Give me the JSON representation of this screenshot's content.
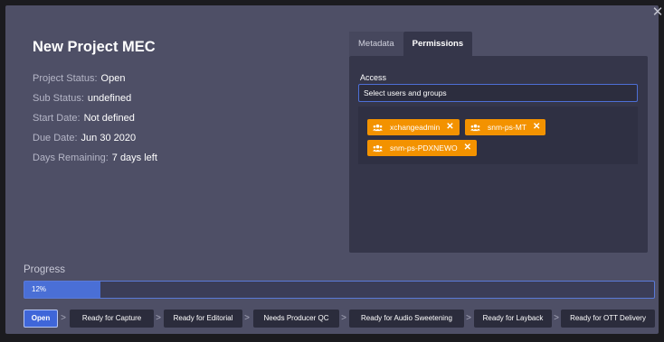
{
  "modal": {
    "title": "New Project MEC",
    "close_glyph": "✕"
  },
  "info": [
    {
      "label": "Project Status:",
      "value": "Open"
    },
    {
      "label": "Sub Status:",
      "value": "undefined"
    },
    {
      "label": "Start Date:",
      "value": "Not defined"
    },
    {
      "label": "Due Date:",
      "value": "Jun 30 2020"
    },
    {
      "label": "Days Remaining:",
      "value": "7 days left"
    }
  ],
  "tabs": [
    {
      "label": "Metadata",
      "active": false
    },
    {
      "label": "Permissions",
      "active": true
    }
  ],
  "permissions": {
    "access_label": "Access",
    "select_placeholder": "Select users and groups",
    "chips": [
      {
        "label": "xchangeadmin",
        "icon": "group-icon"
      },
      {
        "label": "snm-ps-MT",
        "icon": "group-icon"
      },
      {
        "label": "snm-ps-PDXNEWO",
        "icon": "group-icon"
      }
    ],
    "chip_color": "#f39200"
  },
  "progress": {
    "label": "Progress",
    "percent_text": "12%",
    "percent": 12,
    "fill_color": "#4a6fd6"
  },
  "steps": [
    {
      "label": "Open",
      "current": true
    },
    {
      "label": "Ready for Capture",
      "current": false
    },
    {
      "label": "Ready for Editorial",
      "current": false
    },
    {
      "label": "Needs Producer QC",
      "current": false
    },
    {
      "label": "Ready for Audio Sweetening",
      "current": false
    },
    {
      "label": "Ready for Layback",
      "current": false
    },
    {
      "label": "Ready for OTT Delivery",
      "current": false
    }
  ],
  "step_separator": ">"
}
